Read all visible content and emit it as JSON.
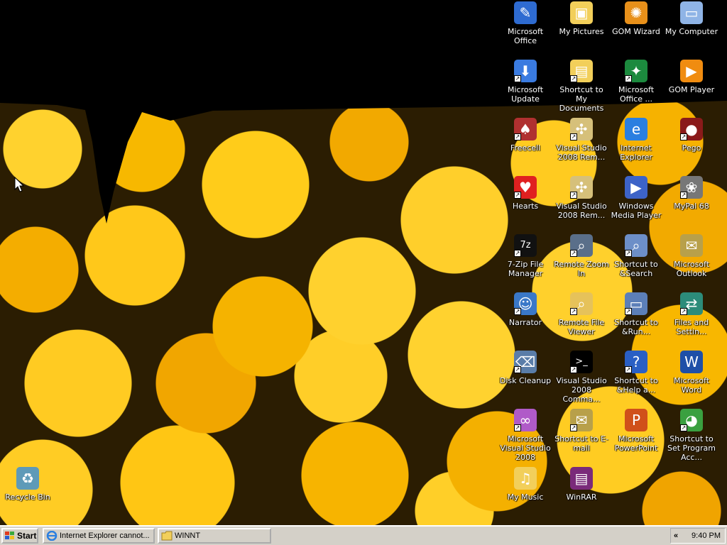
{
  "desktop": {
    "icons": [
      {
        "label": "Microsoft Office",
        "icon": "office-icon",
        "color": "#2e6bd1",
        "glyph": "✎",
        "shortcut": false
      },
      {
        "label": "My Pictures",
        "icon": "pictures-folder-icon",
        "color": "#f2cf5a",
        "glyph": "▣",
        "shortcut": false
      },
      {
        "label": "GOM Wizard",
        "icon": "gom-wizard-icon",
        "color": "#e8901a",
        "glyph": "✺",
        "shortcut": false
      },
      {
        "label": "My Computer",
        "icon": "computer-icon",
        "color": "#8fb4e6",
        "glyph": "▭",
        "shortcut": false
      },
      {
        "label": "Microsoft Update",
        "icon": "update-icon",
        "color": "#3a7be0",
        "glyph": "⬇",
        "shortcut": true
      },
      {
        "label": "Shortcut to My Documents",
        "icon": "documents-folder-icon",
        "color": "#f2cf5a",
        "glyph": "▤",
        "shortcut": true
      },
      {
        "label": "Microsoft Office ...",
        "icon": "office-tools-icon",
        "color": "#1c8a3e",
        "glyph": "✦",
        "shortcut": true
      },
      {
        "label": "GOM Player",
        "icon": "gom-player-icon",
        "color": "#f08c10",
        "glyph": "▶",
        "shortcut": false
      },
      {
        "label": "Freecell",
        "icon": "freecell-icon",
        "color": "#b03030",
        "glyph": "♠",
        "shortcut": true
      },
      {
        "label": "Visual Studio 2008 Rem...",
        "icon": "visual-studio-icon",
        "color": "#d6c07a",
        "glyph": "✣",
        "shortcut": true
      },
      {
        "label": "Internet Explorer",
        "icon": "internet-explorer-icon",
        "color": "#2a7fe0",
        "glyph": "e",
        "shortcut": false
      },
      {
        "label": "Pego",
        "icon": "pego-icon",
        "color": "#8a1a1a",
        "glyph": "●",
        "shortcut": true
      },
      {
        "label": "Hearts",
        "icon": "hearts-icon",
        "color": "#e02020",
        "glyph": "♥",
        "shortcut": true
      },
      {
        "label": "Visual Studio 2008 Rem...",
        "icon": "visual-studio-icon",
        "color": "#d6c07a",
        "glyph": "✣",
        "shortcut": true
      },
      {
        "label": "Windows Media Player",
        "icon": "media-player-icon",
        "color": "#3d63c8",
        "glyph": "▶",
        "shortcut": false
      },
      {
        "label": "MyPal 68",
        "icon": "mypal-icon",
        "color": "#777777",
        "glyph": "❀",
        "shortcut": true
      },
      {
        "label": "7-Zip File Manager",
        "icon": "7zip-icon",
        "color": "#111111",
        "glyph": "7z",
        "shortcut": true
      },
      {
        "label": "Remote Zoom In",
        "icon": "remote-zoom-icon",
        "color": "#5a6f8a",
        "glyph": "⌕",
        "shortcut": true
      },
      {
        "label": "Shortcut to &Search",
        "icon": "search-icon",
        "color": "#6d8fc8",
        "glyph": "⌕",
        "shortcut": true
      },
      {
        "label": "Microsoft Outlook",
        "icon": "outlook-icon",
        "color": "#b8a04a",
        "glyph": "✉",
        "shortcut": false
      },
      {
        "label": "Narrator",
        "icon": "narrator-icon",
        "color": "#3a78c8",
        "glyph": "☺",
        "shortcut": true
      },
      {
        "label": "Remote File Viewer",
        "icon": "file-viewer-icon",
        "color": "#e6c25a",
        "glyph": "⌕",
        "shortcut": true
      },
      {
        "label": "Shortcut to &Run...",
        "icon": "run-icon",
        "color": "#5c7fb8",
        "glyph": "▭",
        "shortcut": true
      },
      {
        "label": "Files and Settin...",
        "icon": "files-settings-icon",
        "color": "#2c8c7a",
        "glyph": "⇄",
        "shortcut": true
      },
      {
        "label": "Disk Cleanup",
        "icon": "disk-cleanup-icon",
        "color": "#5a7da8",
        "glyph": "⌫",
        "shortcut": true
      },
      {
        "label": "Visual Studio 2008 Comma...",
        "icon": "command-prompt-icon",
        "color": "#000000",
        "glyph": ">_",
        "shortcut": true
      },
      {
        "label": "Shortcut to &Help a...",
        "icon": "help-icon",
        "color": "#2a5fc4",
        "glyph": "?",
        "shortcut": true
      },
      {
        "label": "Microsoft Word",
        "icon": "word-icon",
        "color": "#1f4fa8",
        "glyph": "W",
        "shortcut": false
      },
      {
        "label": "Microsoft Visual Studio 2008",
        "icon": "visual-studio-icon",
        "color": "#b05ac8",
        "glyph": "∞",
        "shortcut": true
      },
      {
        "label": "Shortcut to E-mail",
        "icon": "email-icon",
        "color": "#b8a04a",
        "glyph": "✉",
        "shortcut": true
      },
      {
        "label": "Microsoft PowerPoint",
        "icon": "powerpoint-icon",
        "color": "#d0501a",
        "glyph": "P",
        "shortcut": false
      },
      {
        "label": "Shortcut to Set Program Acc...",
        "icon": "set-program-access-icon",
        "color": "#3aa040",
        "glyph": "◕",
        "shortcut": true
      },
      {
        "label": "My Music",
        "icon": "music-folder-icon",
        "color": "#f2cf5a",
        "glyph": "♫",
        "shortcut": false
      },
      {
        "label": "WinRAR",
        "icon": "winrar-icon",
        "color": "#7a2a7a",
        "glyph": "▤",
        "shortcut": false
      },
      {
        "label": "Recycle Bin",
        "icon": "recycle-bin-icon",
        "color": "#5e9ab8",
        "glyph": "♻",
        "shortcut": false
      }
    ]
  },
  "taskbar": {
    "start_label": "Start",
    "tasks": [
      {
        "label": "Internet Explorer cannot...",
        "icon": "internet-explorer-icon"
      },
      {
        "label": "WINNT",
        "icon": "folder-icon"
      }
    ],
    "tray_chevron": "«",
    "clock": "9:40 PM"
  }
}
